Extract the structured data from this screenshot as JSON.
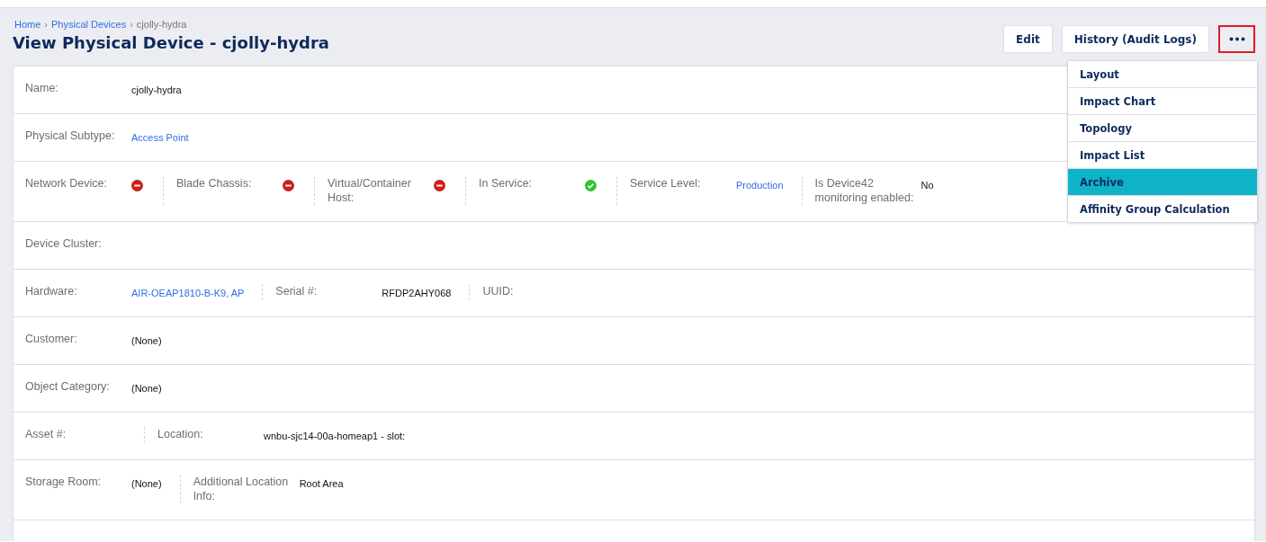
{
  "breadcrumb_separator": "›",
  "breadcrumb": [
    {
      "label": "Home",
      "link": true
    },
    {
      "label": "Physical Devices",
      "link": true
    },
    {
      "label": "cjolly-hydra",
      "link": false
    }
  ],
  "title": "View Physical Device - cjolly-hydra",
  "actions": [
    {
      "label": "Edit"
    },
    {
      "label": "History (Audit Logs)"
    }
  ],
  "more_menu": {
    "open": true,
    "items": [
      {
        "label": "Layout",
        "selected": false
      },
      {
        "label": "Impact Chart",
        "selected": false
      },
      {
        "label": "Topology",
        "selected": false
      },
      {
        "label": "Impact List",
        "selected": false
      },
      {
        "label": "Archive",
        "selected": true
      },
      {
        "label": "Affinity Group Calculation",
        "selected": false
      }
    ]
  },
  "rows": [
    {
      "fields": [
        {
          "label": "Name:",
          "kind": "text",
          "value": "cjolly-hydra"
        }
      ]
    },
    {
      "fields": [
        {
          "label": "Physical Subtype:",
          "kind": "link",
          "value": "Access Point"
        }
      ]
    },
    {
      "fields": [
        {
          "label": "Network Device:",
          "kind": "flag",
          "on": false
        },
        {
          "label": "Blade Chassis:",
          "kind": "flag",
          "on": false
        },
        {
          "label": "Virtual/Container Host:",
          "kind": "flag",
          "on": false
        },
        {
          "label": "In Service:",
          "kind": "flag",
          "on": true
        },
        {
          "label": "Service Level:",
          "kind": "link",
          "value": "Production"
        },
        {
          "label": "Is Device42 monitoring enabled:",
          "kind": "text",
          "value": "No"
        }
      ]
    },
    {
      "fields": [
        {
          "label": "Device Cluster:",
          "kind": "empty"
        }
      ]
    },
    {
      "fields": [
        {
          "label": "Hardware:",
          "kind": "link",
          "value": "AIR-OEAP1810-B-K9, AP"
        },
        {
          "label": "Serial #:",
          "kind": "text",
          "value": "RFDP2AHY068"
        },
        {
          "label": "UUID:",
          "kind": "empty"
        }
      ]
    },
    {
      "fields": [
        {
          "label": "Customer:",
          "kind": "text",
          "value": "(None)"
        }
      ]
    },
    {
      "fields": [
        {
          "label": "Object Category:",
          "kind": "text",
          "value": "(None)"
        }
      ]
    },
    {
      "fields": [
        {
          "label": "Asset #:",
          "kind": "empty"
        },
        {
          "label": "Location:",
          "kind": "text",
          "value": "wnbu-sjc14-00a-homeap1 - slot:"
        }
      ]
    },
    {
      "fields": [
        {
          "label": "Storage Room:",
          "kind": "text",
          "value": "(None)"
        },
        {
          "label": "Additional Location Info:",
          "kind": "text",
          "value": "Root Area"
        }
      ]
    },
    {
      "fields": []
    }
  ]
}
